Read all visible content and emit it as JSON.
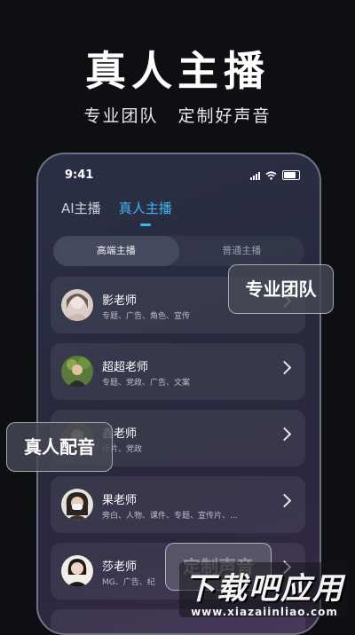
{
  "promo": {
    "headline": "真人主播",
    "sub_left": "专业团队",
    "sub_right": "定制好声音"
  },
  "status_bar": {
    "time": "9:41"
  },
  "tabs": [
    {
      "label": "AI主播",
      "active": false
    },
    {
      "label": "真人主播",
      "active": true
    }
  ],
  "segments": [
    {
      "label": "高端主播",
      "active": true
    },
    {
      "label": "普通主播",
      "active": false
    }
  ],
  "hosts": [
    {
      "name": "影老师",
      "tags": "专题、广告、角色、宣传"
    },
    {
      "name": "超超老师",
      "tags": "专题、党政、广告、文案"
    },
    {
      "name": "鑫老师",
      "tags": "传片、党政"
    },
    {
      "name": "果老师",
      "tags": "旁白、人物、课件、专题、宣传片、..."
    },
    {
      "name": "莎老师",
      "tags": "MG、广告、纪"
    }
  ],
  "bubbles": {
    "team": "专业团队",
    "dubbing": "真人配音",
    "custom": "定制声音"
  },
  "watermark": {
    "title": "下载吧应用",
    "url": "www.xiazaiinliao.com"
  },
  "colors": {
    "accent": "#3fb6f2",
    "background": "#0e0f13"
  }
}
